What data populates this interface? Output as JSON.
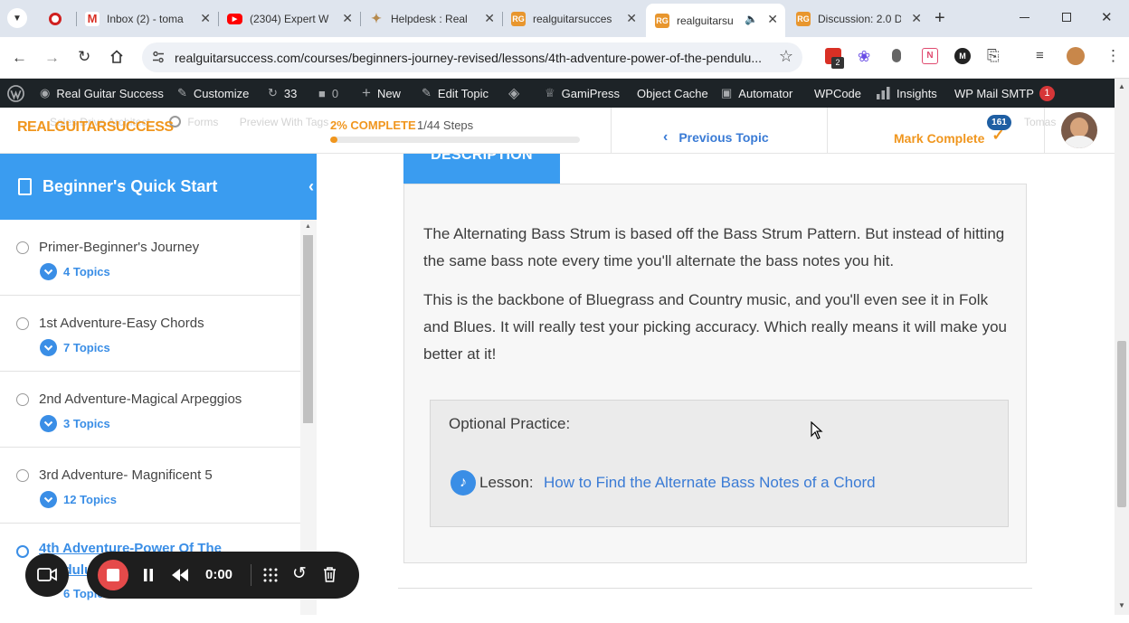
{
  "browser": {
    "tabs": [
      {
        "title": "",
        "icon": "record-icon"
      },
      {
        "title": "Inbox (2) - toma",
        "icon": "gmail-icon"
      },
      {
        "title": "(2304) Expert W",
        "icon": "youtube-icon"
      },
      {
        "title": "Helpdesk : Real",
        "icon": "helpdesk-icon"
      },
      {
        "title": "realguitarsucces",
        "icon": "rgs-icon"
      },
      {
        "title": "realguitarsu",
        "icon": "rgs-icon",
        "active": true,
        "audio": true
      },
      {
        "title": "Discussion: 2.0 D",
        "icon": "rgs-icon"
      }
    ],
    "url": "realguitarsuccess.com/courses/beginners-journey-revised/lessons/4th-adventure-power-of-the-pendulu...",
    "ext_badge": "2"
  },
  "wpbar": {
    "site": "Real Guitar Success",
    "customize": "Customize",
    "updates": "33",
    "comments": "0",
    "new": "New",
    "edit": "Edit Topic",
    "gamipress": "GamiPress",
    "object_cache": "Object Cache",
    "automator": "Automator",
    "wpcode": "WPCode",
    "insights": "Insights",
    "mail": "WP Mail SMTP",
    "mail_badge": "1"
  },
  "header": {
    "logo": "REALGUITARSUCCESS",
    "faded_nav": [
      "Sales Drive Architect",
      "Forms",
      "Preview With Tags",
      "Tomas"
    ],
    "progress_label": "2% COMPLETE",
    "progress_steps": "1/44 Steps",
    "progress": 0.02,
    "prev": "Previous Topic",
    "mark": "Mark Complete",
    "points_badge": "161"
  },
  "sidebar": {
    "title": "Beginner's Quick Start",
    "lessons": [
      {
        "title": "Primer-Beginner's Journey",
        "topics": "4 Topics"
      },
      {
        "title": "1st Adventure-Easy Chords",
        "topics": "7 Topics"
      },
      {
        "title": "2nd Adventure-Magical Arpeggios",
        "topics": "3 Topics"
      },
      {
        "title": "3rd Adventure- Magnificent 5",
        "topics": "12 Topics"
      },
      {
        "title": "4th Adventure-Power Of The Pendulum",
        "topics": "6 Topics",
        "active": true
      }
    ]
  },
  "content": {
    "tab": "DESCRIPTION",
    "para1": "The Alternating Bass Strum is based off the Bass Strum Pattern. But instead of hitting the same bass note every time you'll alternate the bass notes you hit.",
    "para2": "This is the backbone of Bluegrass and Country music, and you'll even see it in Folk and Blues. It will really test your picking accuracy. Which really means it will make you better at it!",
    "practice_title": "Optional Practice:",
    "lesson_label": "Lesson:",
    "lesson_link": "How to Find the Alternate Bass Notes of a Chord"
  },
  "recorder": {
    "time": "0:00"
  },
  "colors": {
    "accent_blue": "#3a9cf0",
    "orange": "#f0961e",
    "wp_bar": "#1d2327",
    "link": "#3a7bd5"
  }
}
